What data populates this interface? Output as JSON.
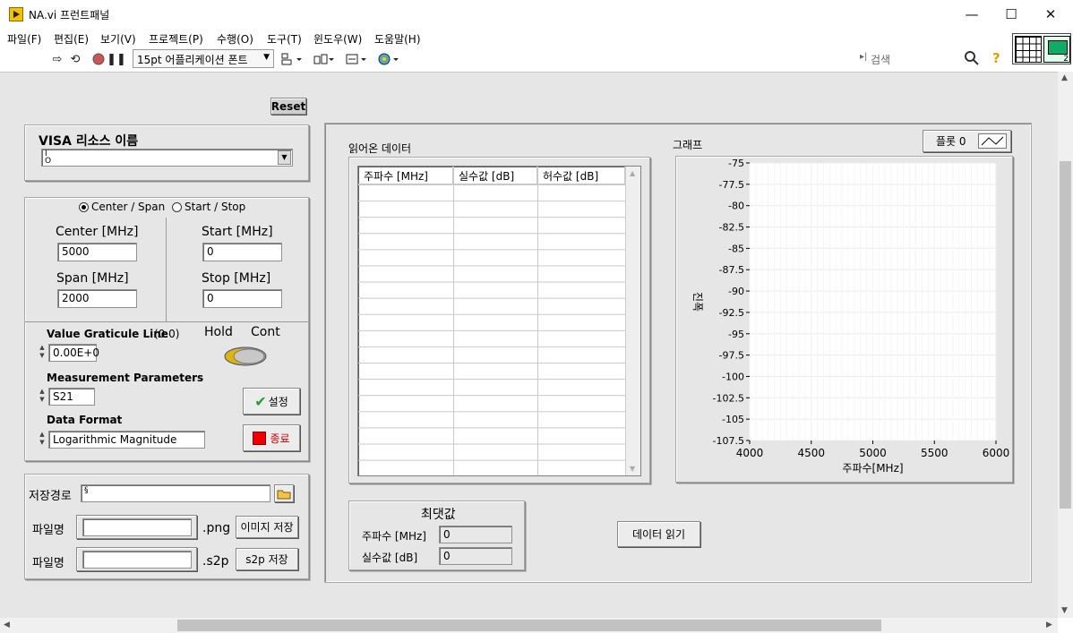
{
  "window": {
    "title": "NA.vi 프런트패널",
    "minimize": "—",
    "maximize": "☐",
    "close": "✕"
  },
  "menu": [
    "파일(F)",
    "편집(E)",
    "보기(V)",
    "프로젝트(P)",
    "수행(O)",
    "도구(T)",
    "윈도우(W)",
    "도움말(H)"
  ],
  "toolbar": {
    "font_select": "15pt 어플리케이션 폰트",
    "search_placeholder": "검색",
    "icons": [
      "run-arrow-icon",
      "run-continuous-icon",
      "abort-icon",
      "pause-icon",
      "align-icon",
      "distribute-icon",
      "resize-icon",
      "reorder-icon",
      "search-icon",
      "help-icon"
    ],
    "connector_number": "2"
  },
  "reset_button": "Reset",
  "visa": {
    "label": "VISA 리소스 이름",
    "value": ""
  },
  "mode": {
    "option_center": "Center / Span",
    "option_start": "Start / Stop",
    "selected": "Center / Span",
    "center_label": "Center [MHz]",
    "center_value": "5000",
    "span_label": "Span [MHz]",
    "span_value": "2000",
    "start_label": "Start [MHz]",
    "start_value": "0",
    "stop_label": "Stop [MHz]",
    "stop_value": "0"
  },
  "settings": {
    "graticule_label": "Value Graticule Line",
    "graticule_note": "(0.0)",
    "graticule_value": "0.00E+0",
    "hold_label": "Hold",
    "cont_label": "Cont",
    "meas_label": "Measurement Parameters",
    "meas_value": "S21",
    "format_label": "Data Format",
    "format_value": "Logarithmic Magnitude",
    "set_button": "설정",
    "stop_button": "종료"
  },
  "save": {
    "path_label": "저장경로",
    "path_value": "",
    "file_label_1": "파일명",
    "file_value_1": "",
    "ext_1": ".png",
    "save_image_button": "이미지 저장",
    "file_label_2": "파일명",
    "file_value_2": "",
    "ext_2": ".s2p",
    "save_s2p_button": "s2p 저장"
  },
  "table": {
    "title": "읽어온 데이터",
    "columns": [
      "주파수 [MHz]",
      "실수값 [dB]",
      "허수값 [dB]"
    ]
  },
  "graph": {
    "title": "그래프",
    "plot_legend": "플롯 0"
  },
  "chart_data": {
    "type": "line",
    "title": "그래프",
    "xlabel": "주파수[MHz]",
    "ylabel": "진폭",
    "xlim": [
      4000,
      6000
    ],
    "ylim": [
      -107.5,
      -75
    ],
    "x_ticks": [
      4000,
      4500,
      5000,
      5500,
      6000
    ],
    "y_ticks": [
      -75,
      -77.5,
      -80,
      -82.5,
      -85,
      -87.5,
      -90,
      -92.5,
      -95,
      -97.5,
      -100,
      -102.5,
      -105,
      -107.5
    ],
    "grid": true,
    "series": [
      {
        "name": "플롯 0",
        "x": [],
        "y": []
      }
    ]
  },
  "max": {
    "title": "최댓값",
    "freq_label": "주파수 [MHz]",
    "freq_value": "0",
    "real_label": "실수값 [dB]",
    "real_value": "0"
  },
  "read_button": "데이터 읽기"
}
